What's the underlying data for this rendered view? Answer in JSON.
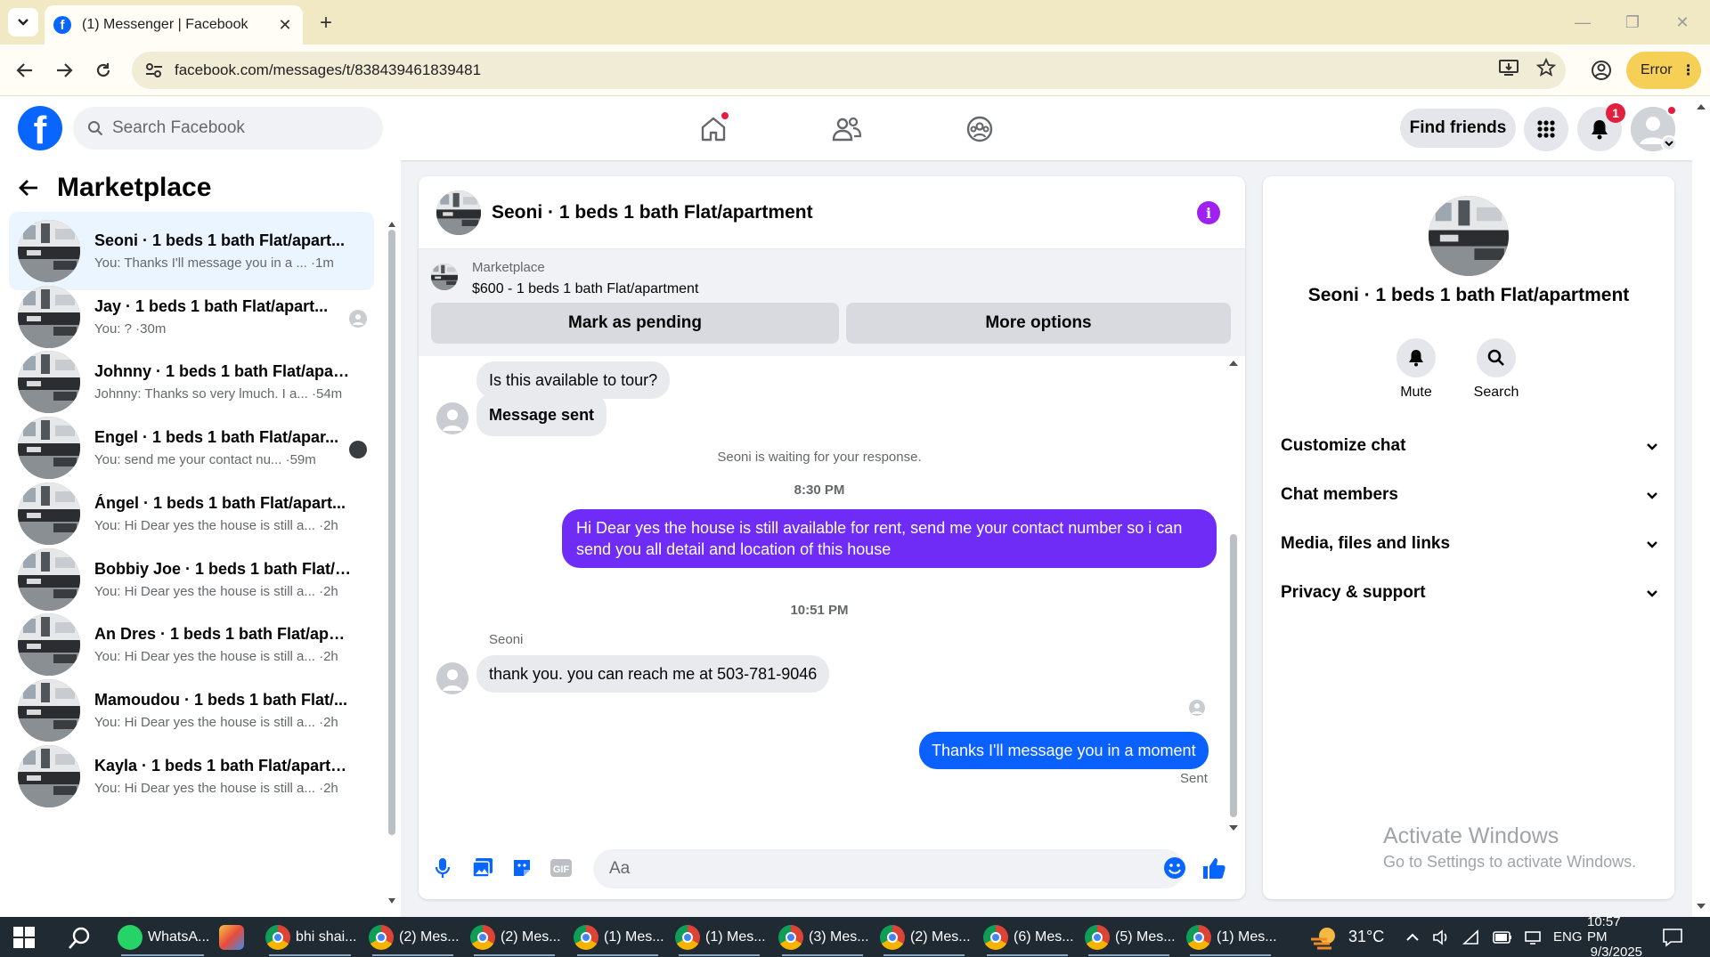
{
  "browser": {
    "tab_title": "(1) Messenger | Facebook",
    "tab_favicon": "facebook-icon",
    "url": "facebook.com/messages/t/838439461839481",
    "error_label": "Error"
  },
  "fb_header": {
    "search_placeholder": "Search Facebook",
    "find_friends": "Find friends",
    "notification_count": "1",
    "brand_color": "#0866ff"
  },
  "sidebar": {
    "title": "Marketplace",
    "conversations": [
      {
        "name": "Seoni · 1 beds 1 bath Flat/apart...",
        "preview": "You: Thanks I'll message you in a ... ·1m",
        "active": true
      },
      {
        "name": "Jay · 1 beds 1 bath Flat/apart...",
        "preview": "You: ? ·30m",
        "active": false
      },
      {
        "name": "Johnny · 1 beds 1 bath Flat/apart...",
        "preview": "Johnny: Thanks so very lmuch. I a... ·54m",
        "active": false
      },
      {
        "name": "Engel · 1 beds 1 bath Flat/apar...",
        "preview": "You: send me your contact nu... ·59m",
        "active": false
      },
      {
        "name": "Ángel · 1 beds 1 bath Flat/apart...",
        "preview": "You: Hi Dear yes the house is still a... ·2h",
        "active": false
      },
      {
        "name": "Bobbiy Joe · 1 beds 1 bath Flat/a...",
        "preview": "You: Hi Dear yes the house is still a... ·2h",
        "active": false
      },
      {
        "name": "An Dres · 1 beds 1 bath Flat/apar...",
        "preview": "You: Hi Dear yes the house is still a... ·2h",
        "active": false
      },
      {
        "name": "Mamoudou · 1 beds 1 bath Flat/...",
        "preview": "You: Hi Dear yes the house is still a... ·2h",
        "active": false
      },
      {
        "name": "Kayla · 1 beds 1 bath Flat/apartm...",
        "preview": "You: Hi Dear yes the house is still a... ·2h",
        "active": false
      }
    ]
  },
  "chat": {
    "title": "Seoni · 1 beds 1 bath Flat/apartment",
    "marketplace_label": "Marketplace",
    "listing": "$600 - 1 beds 1 bath Flat/apartment",
    "mark_pending": "Mark as pending",
    "more_options": "More options",
    "msg_tour": "Is this available to tour?",
    "msg_sent_card": "Message sent",
    "waiting_note": "Seoni is waiting for your response.",
    "time1": "8:30 PM",
    "msg_out1": "Hi Dear yes the house is still available for rent, send me your contact number so i can send you all detail and location of this house",
    "time2": "10:51 PM",
    "sender": "Seoni",
    "msg_in2": "thank you. you can reach me at 503-781-9046",
    "msg_out2": "Thanks I'll message you in a moment",
    "sent_status": "Sent",
    "compose_placeholder": "Aa",
    "accent_color": "#6f2cf6"
  },
  "info_panel": {
    "name": "Seoni · 1 beds 1 bath Flat/apartment",
    "mute": "Mute",
    "search": "Search",
    "rows": [
      "Customize chat",
      "Chat members",
      "Media, files and links",
      "Privacy & support"
    ]
  },
  "watermark": {
    "line1": "Activate Windows",
    "line2": "Go to Settings to activate Windows."
  },
  "taskbar": {
    "items": [
      "WhatsA...",
      "",
      "bhi shai...",
      "(2) Mes...",
      "(2) Mes...",
      "(1) Mes...",
      "(1) Mes...",
      "(3) Mes...",
      "(2) Mes...",
      "(6) Mes...",
      "(5) Mes...",
      "(1) Mes..."
    ],
    "weather": "31°C",
    "lang": "ENG",
    "time": "10:57 PM",
    "date": "9/3/2025"
  }
}
